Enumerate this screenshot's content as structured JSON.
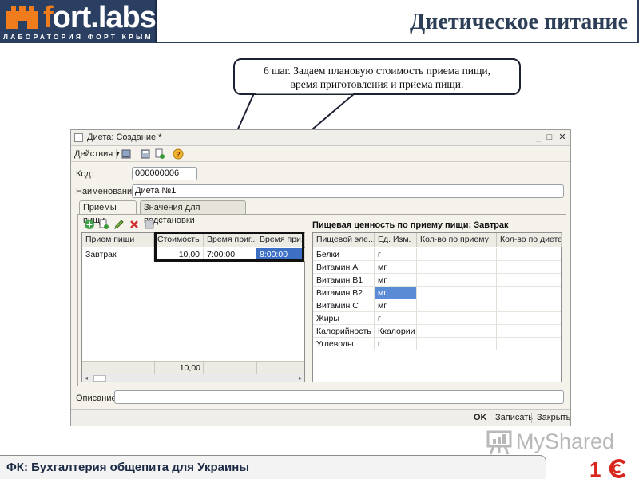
{
  "header": {
    "logo_text_f": "f",
    "logo_text_rest": "ort.labs",
    "logo_subtitle": "ЛАБОРАТОРИЯ ФОРТ КРЫМ",
    "page_title": "Диетическое питание"
  },
  "callout": {
    "line1": "6 шаг. Задаем плановую стоимость приема пищи,",
    "line2": "время приготовления и приема пищи."
  },
  "window": {
    "title": "Диета: Создание *",
    "controls": {
      "minimize": "_",
      "maximize": "□",
      "close": "✕"
    },
    "toolbar": {
      "actions": "Действия ▾"
    },
    "code_label": "Код:",
    "code_value": "000000006",
    "name_label": "Наименование:",
    "name_value": "Диета №1",
    "tabs": [
      {
        "label": "Приемы пищи"
      },
      {
        "label": "Значения для подстановки"
      }
    ],
    "meals_grid": {
      "columns": [
        "Прием пищи",
        "Стоимость",
        "Время приг...",
        "Время при..."
      ],
      "rows": [
        {
          "meal": "Завтрак",
          "cost": "10,00",
          "prep_time": "7:00:00",
          "meal_time": "8:00:00"
        }
      ],
      "total_cost": "10,00"
    },
    "nutrition": {
      "title": "Пищевая ценность по приему пищи: Завтрак",
      "columns": [
        "Пищевой эле...",
        "Ед. Изм.",
        "Кол-во по приему",
        "Кол-во по диете"
      ],
      "rows": [
        {
          "element": "Белки",
          "unit": "г"
        },
        {
          "element": "Витамин А",
          "unit": "мг"
        },
        {
          "element": "Витамин В1",
          "unit": "мг"
        },
        {
          "element": "Витамин В2",
          "unit": "мг"
        },
        {
          "element": "Витамин С",
          "unit": "мг"
        },
        {
          "element": "Жиры",
          "unit": "г"
        },
        {
          "element": "Калорийность",
          "unit": "Ккалории"
        },
        {
          "element": "Углеводы",
          "unit": "г"
        }
      ]
    },
    "description_label": "Описание:",
    "description_value": "",
    "buttons": {
      "ok": "OK",
      "save": "Записать",
      "close": "Закрыть"
    }
  },
  "watermark": {
    "text": "MyShared"
  },
  "footer": {
    "text": "ФК: Бухгалтерия общепита для Украины"
  },
  "colors": {
    "navy": "#2b3f63",
    "orange": "#f07c1b",
    "selection": "#3d6fc4",
    "onec_red": "#d9261c"
  }
}
